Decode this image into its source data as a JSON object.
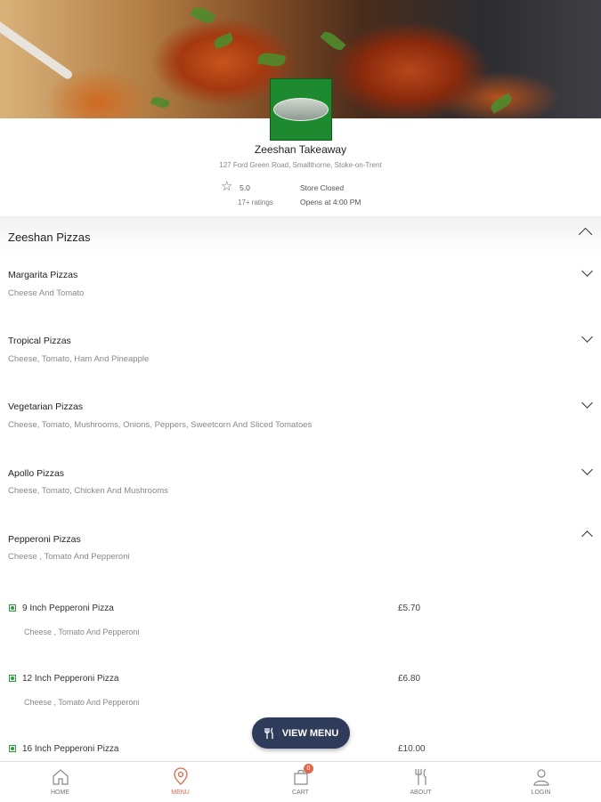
{
  "store": {
    "name": "Zeeshan Takeaway",
    "address": "127 Ford Green Road, Smallthorne, Stoke-on-Trent",
    "rating": "5.0",
    "rating_count": "17+ ratings",
    "status": "Store Closed",
    "opens": "Opens at 4:00 PM"
  },
  "category": {
    "title": "Zeeshan Pizzas",
    "subcategories": [
      {
        "title": "Margarita Pizzas",
        "desc": "Cheese And Tomato",
        "expanded": false
      },
      {
        "title": "Tropical Pizzas",
        "desc": "Cheese, Tomato, Ham And Pineapple",
        "expanded": false
      },
      {
        "title": "Vegetarian Pizzas",
        "desc": "Cheese, Tomato, Mushrooms, Onions, Peppers, Sweetcorn And Sliced Tomatoes",
        "expanded": false
      },
      {
        "title": "Apollo Pizzas",
        "desc": "Cheese, Tomato, Chicken And Mushrooms",
        "expanded": false
      },
      {
        "title": "Pepperoni Pizzas",
        "desc": "Cheese , Tomato And Pepperoni",
        "expanded": true
      }
    ]
  },
  "items": [
    {
      "name": "9 Inch Pepperoni Pizza",
      "price": "£5.70",
      "desc": "Cheese , Tomato And Pepperoni"
    },
    {
      "name": "12 Inch Pepperoni Pizza",
      "price": "£6.80",
      "desc": "Cheese , Tomato And Pepperoni"
    },
    {
      "name": "16 Inch Pepperoni Pizza",
      "price": "£10.00"
    }
  ],
  "view_menu_label": "VIEW MENU",
  "nav": {
    "home": "HOME",
    "menu": "MENU",
    "cart": "CART",
    "cart_count": "0",
    "about": "ABOUT",
    "login": "LOGIN"
  },
  "colors": {
    "accent": "#e0664a",
    "veg_indicator": "#2e9b3d",
    "view_menu_bg": "#2f3b5a",
    "logo_bg": "#1e8a2f"
  }
}
